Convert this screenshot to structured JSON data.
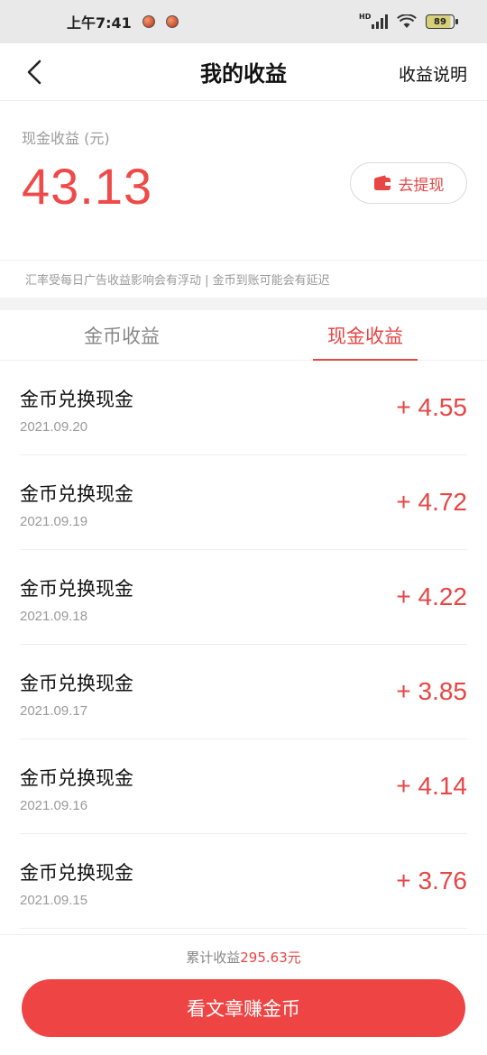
{
  "status_bar": {
    "time": "上午7:41",
    "network_label": "HD",
    "battery": "89"
  },
  "header": {
    "title": "我的收益",
    "right_link": "收益说明"
  },
  "balance": {
    "label": "现金收益 (元)",
    "amount": "43.13",
    "withdraw_label": "去提现"
  },
  "notice": "汇率受每日广告收益影响会有浮动 | 金币到账可能会有延迟",
  "tabs": [
    {
      "label": "金币收益",
      "active": false
    },
    {
      "label": "现金收益",
      "active": true
    }
  ],
  "records": [
    {
      "title": "金币兑换现金",
      "date": "2021.09.20",
      "amount": "+ 4.55"
    },
    {
      "title": "金币兑换现金",
      "date": "2021.09.19",
      "amount": "+ 4.72"
    },
    {
      "title": "金币兑换现金",
      "date": "2021.09.18",
      "amount": "+ 4.22"
    },
    {
      "title": "金币兑换现金",
      "date": "2021.09.17",
      "amount": "+ 3.85"
    },
    {
      "title": "金币兑换现金",
      "date": "2021.09.16",
      "amount": "+ 4.14"
    },
    {
      "title": "金币兑换现金",
      "date": "2021.09.15",
      "amount": "+ 3.76"
    }
  ],
  "footer": {
    "total_label": "累计收益",
    "total_value": "295.63元",
    "cta_label": "看文章赚金币"
  },
  "colors": {
    "accent": "#e84545",
    "muted": "#9a9a9a"
  }
}
